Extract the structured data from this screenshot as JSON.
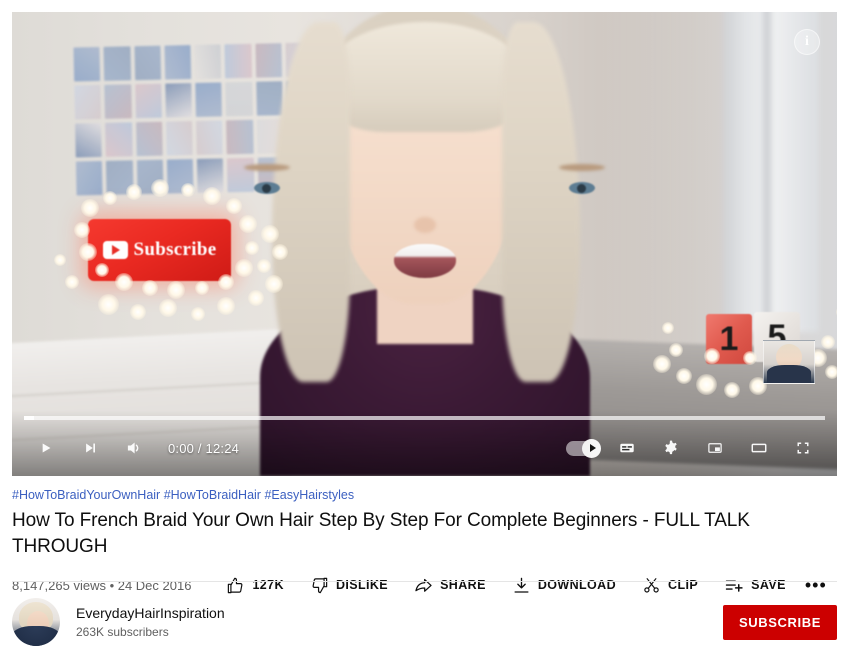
{
  "player": {
    "info_button_label": "i",
    "progress": {
      "played_percent": 1.2,
      "loaded_percent": 100
    },
    "time_display": "0:00 / 12:24",
    "controls": {
      "play_label": "Play",
      "next_label": "Next",
      "volume_label": "Mute",
      "autoplay_label": "Autoplay",
      "subtitles_label": "Subtitles/closed captions",
      "settings_label": "Settings",
      "miniplayer_label": "Miniplayer",
      "theater_label": "Theater mode",
      "fullscreen_label": "Full screen"
    },
    "scene": {
      "lightbox_text": "Subscribe",
      "block_left": "1",
      "block_right": "5"
    }
  },
  "meta": {
    "hashtags": [
      "#HowToBraidYourOwnHair",
      "#HowToBraidHair",
      "#EasyHairstyles"
    ],
    "title": "How To French Braid Your Own Hair Step By Step For Complete Beginners - FULL TALK THROUGH",
    "views": "8,147,265 views",
    "separator": "•",
    "date": "24 Dec 2016",
    "views_line": "8,147,265 views • 24 Dec 2016",
    "actions": [
      {
        "name": "like",
        "label": "127K"
      },
      {
        "name": "dislike",
        "label": "DISLIKE"
      },
      {
        "name": "share",
        "label": "SHARE"
      },
      {
        "name": "download",
        "label": "DOWNLOAD"
      },
      {
        "name": "clip",
        "label": "CLIP"
      },
      {
        "name": "save",
        "label": "SAVE"
      }
    ],
    "more_label": "•••"
  },
  "channel": {
    "name": "EverydayHairInspiration",
    "subscribers": "263K subscribers",
    "subscribe_label": "SUBSCRIBE"
  },
  "colors": {
    "hashtag_blue": "#3b5fc0",
    "subscribe_red": "#cc0000",
    "text_primary": "#0f0f0f",
    "text_secondary": "#606060",
    "divider": "#e5e5e5"
  }
}
